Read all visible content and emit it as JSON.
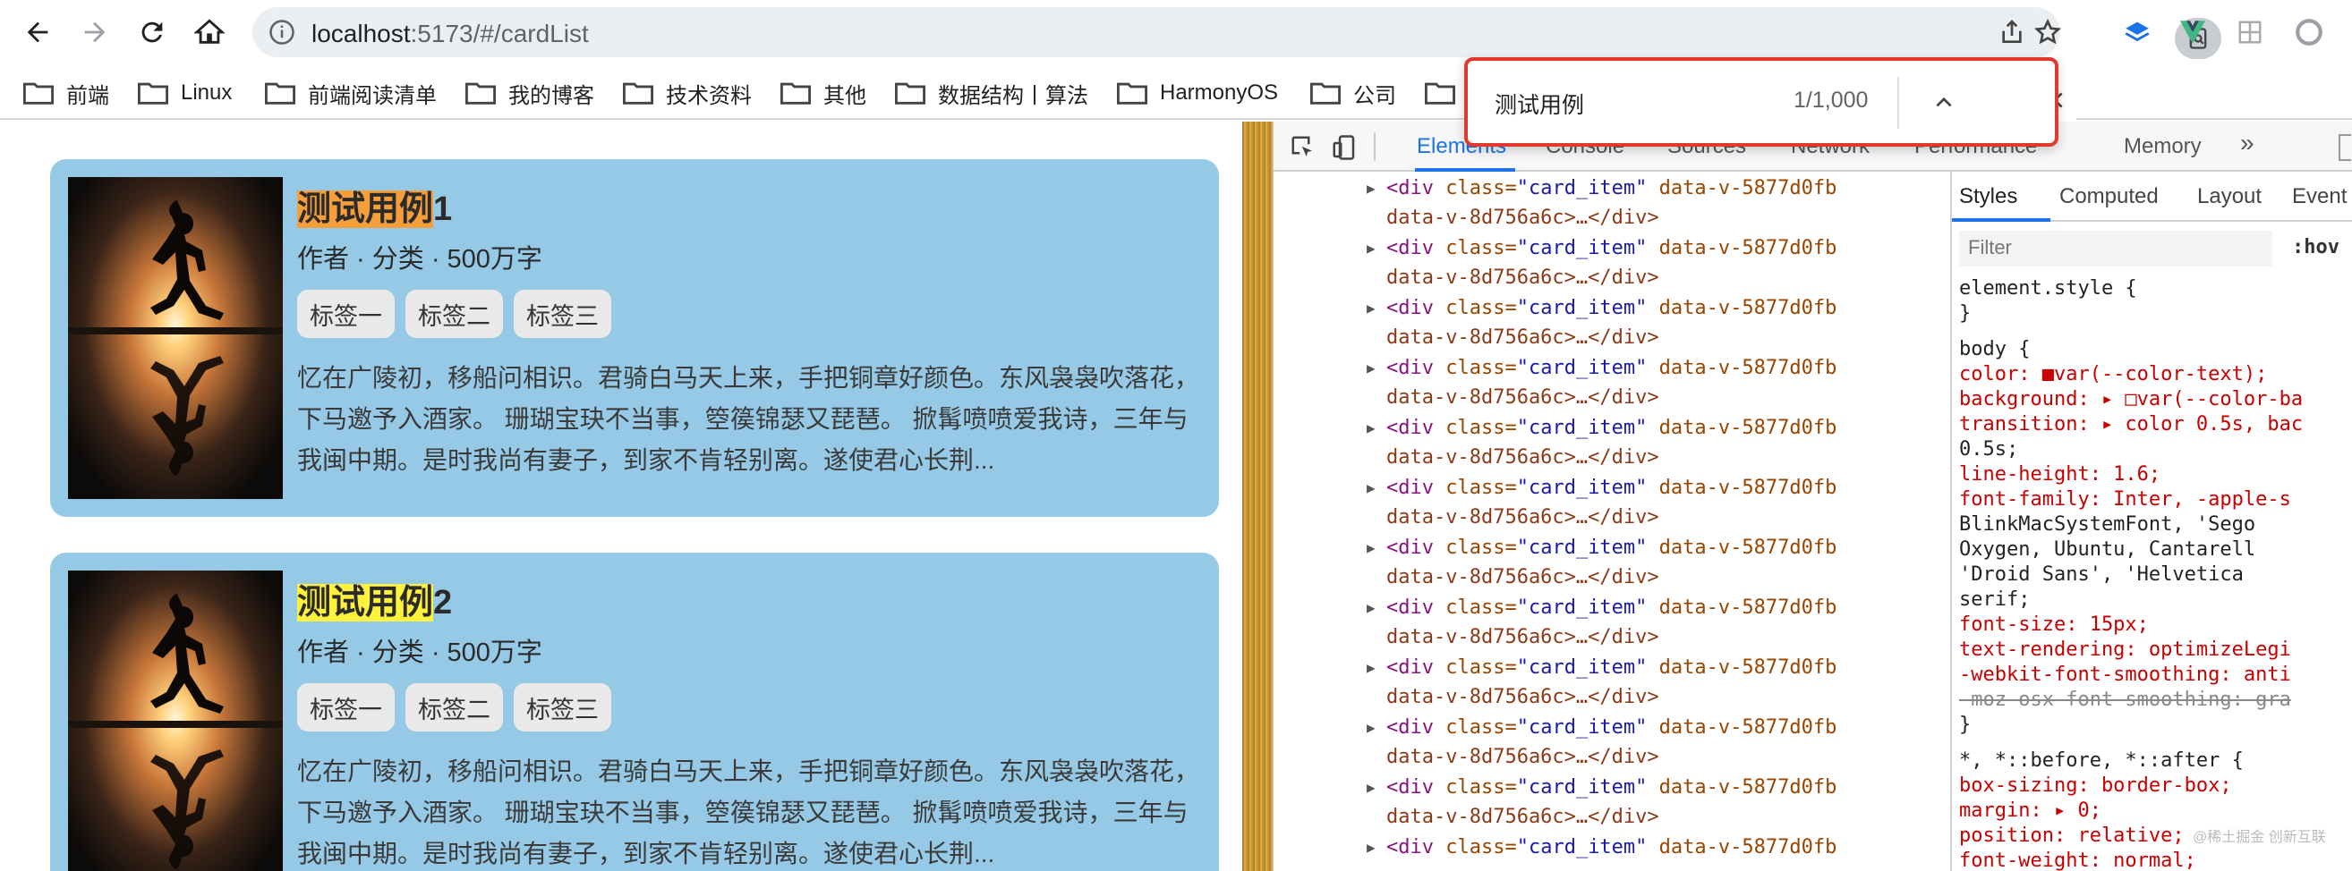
{
  "browser": {
    "url_host": "localhost",
    "url_path": ":5173/#/cardList"
  },
  "bookmarks": [
    "前端",
    "Linux",
    "前端阅读清单",
    "我的博客",
    "技术资料",
    "其他",
    "数据结构丨算法",
    "HarmonyOS",
    "公司"
  ],
  "find_bar": {
    "query": "测试用例",
    "count": "1/1,000"
  },
  "cards": [
    {
      "title_match": "测试用例",
      "title_suffix": "1",
      "meta": "作者 · 分类 · 500万字",
      "tags": [
        "标签一",
        "标签二",
        "标签三"
      ],
      "desc": "忆在广陵初，移船问相识。君骑白马天上来，手把铜章好颜色。东风袅袅吹落花，下马邀予入酒家。 珊瑚宝玦不当事，箜篌锦瑟又琵琶。 掀髯喷喷爱我诗，三年与我闽中期。是时我尚有妻子，到家不肯轻别离。遂使君心长荆..."
    },
    {
      "title_match": "测试用例",
      "title_suffix": "2",
      "meta": "作者 · 分类 · 500万字",
      "tags": [
        "标签一",
        "标签二",
        "标签三"
      ],
      "desc": "忆在广陵初，移船问相识。君骑白马天上来，手把铜章好颜色。东风袅袅吹落花，下马邀予入酒家。 珊瑚宝玦不当事，箜篌锦瑟又琵琶。 掀髯喷喷爱我诗，三年与我闽中期。是时我尚有妻子，到家不肯轻别离。遂使君心长荆..."
    }
  ],
  "devtools": {
    "tabs": [
      "Elements",
      "Console",
      "Sources",
      "Network",
      "Performance",
      "Memory"
    ],
    "more": "»",
    "element_rows": [
      {
        "tag_open": "<div",
        "attr_name": "class=",
        "attr_value": "\"card_item\"",
        "data_attr": "data-v-5877d0fb",
        "line2": "data-v-8d756a6c>…</div>"
      },
      {
        "tag_open": "<div",
        "attr_name": "class=",
        "attr_value": "\"card_item\"",
        "data_attr": "data-v-5877d0fb",
        "line2": "data-v-8d756a6c>…</div>"
      },
      {
        "tag_open": "<div",
        "attr_name": "class=",
        "attr_value": "\"card_item\"",
        "data_attr": "data-v-5877d0fb",
        "line2": "data-v-8d756a6c>…</div>"
      },
      {
        "tag_open": "<div",
        "attr_name": "class=",
        "attr_value": "\"card_item\"",
        "data_attr": "data-v-5877d0fb",
        "line2": "data-v-8d756a6c>…</div>"
      },
      {
        "tag_open": "<div",
        "attr_name": "class=",
        "attr_value": "\"card_item\"",
        "data_attr": "data-v-5877d0fb",
        "line2": "data-v-8d756a6c>…</div>"
      },
      {
        "tag_open": "<div",
        "attr_name": "class=",
        "attr_value": "\"card_item\"",
        "data_attr": "data-v-5877d0fb",
        "line2": "data-v-8d756a6c>…</div>"
      },
      {
        "tag_open": "<div",
        "attr_name": "class=",
        "attr_value": "\"card_item\"",
        "data_attr": "data-v-5877d0fb",
        "line2": "data-v-8d756a6c>…</div>"
      },
      {
        "tag_open": "<div",
        "attr_name": "class=",
        "attr_value": "\"card_item\"",
        "data_attr": "data-v-5877d0fb",
        "line2": "data-v-8d756a6c>…</div>"
      },
      {
        "tag_open": "<div",
        "attr_name": "class=",
        "attr_value": "\"card_item\"",
        "data_attr": "data-v-5877d0fb",
        "line2": "data-v-8d756a6c>…</div>"
      },
      {
        "tag_open": "<div",
        "attr_name": "class=",
        "attr_value": "\"card_item\"",
        "data_attr": "data-v-5877d0fb",
        "line2": "data-v-8d756a6c>…</div>"
      },
      {
        "tag_open": "<div",
        "attr_name": "class=",
        "attr_value": "\"card_item\"",
        "data_attr": "data-v-5877d0fb",
        "line2": "data-v-8d756a6c>…</div>"
      },
      {
        "tag_open": "<div",
        "attr_name": "class=",
        "attr_value": "\"card_item\"",
        "data_attr": "data-v-5877d0fb",
        "line2": ""
      }
    ],
    "styles_tabs": [
      "Styles",
      "Computed",
      "Layout",
      "Event"
    ],
    "filter_placeholder": "Filter",
    "hov": ":hov",
    "css_lines": [
      "element.style {",
      "}",
      "body {",
      "  color: ■var(--color-text);",
      "  background: ▸ □var(--color-ba",
      "  transition: ▸ color 0.5s, bac",
      "     0.5s;",
      "  line-height: 1.6;",
      "  font-family: Inter, -apple-s",
      "     BlinkMacSystemFont, 'Sego",
      "     Oxygen, Ubuntu, Cantarell",
      "     'Droid Sans', 'Helvetica",
      "     serif;",
      "  font-size: 15px;",
      "  text-rendering: optimizeLegi",
      "  -webkit-font-smoothing: anti",
      "  -moz-osx-font-smoothing: gra",
      "}",
      "*, *::before, *::after {",
      "  box-sizing: border-box;",
      "  margin: ▸ 0;",
      "  position: relative;",
      "  font-weight: normal;"
    ]
  },
  "watermark": "@稀土掘金  创新互联",
  "colors": {
    "card_bg": "#95c9e6",
    "current_match": "#f59e3a",
    "other_match": "#fff23d",
    "find_border": "#e03a2c",
    "active_tab": "#1a73e8"
  }
}
